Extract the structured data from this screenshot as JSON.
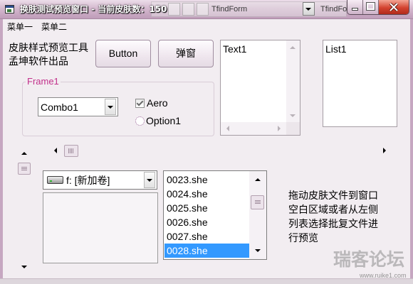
{
  "window": {
    "title": "换肤测试预览窗口 - 当前皮肤数：150",
    "background_windows": [
      "TfindForm",
      "TfindFo"
    ]
  },
  "menu": [
    "菜单一",
    "菜单二"
  ],
  "intro": [
    "皮肤样式预览工具",
    "孟坤软件出品"
  ],
  "buttons": {
    "button": "Button",
    "popup": "弹窗"
  },
  "text1": {
    "value": "Text1"
  },
  "list1": {
    "items": [
      "List1"
    ]
  },
  "frame": {
    "label": "Frame1",
    "combo": {
      "value": "Combo1"
    },
    "checkbox": {
      "label": "Aero",
      "checked": true
    },
    "radio": {
      "label": "Option1",
      "selected": false
    }
  },
  "drive": {
    "value": "f: [新加卷]",
    "icon": "hard-drive-icon"
  },
  "file_list": {
    "items": [
      "0023.she",
      "0024.she",
      "0025.she",
      "0026.she",
      "0027.she",
      "0028.she"
    ],
    "selected_index": 5
  },
  "instructions": [
    "拖动皮肤文件到窗口",
    "空白区域或者从左侧",
    "列表选择批复文件进",
    "行预览"
  ],
  "scroll": {
    "main_horizontal": 0,
    "main_vertical": 0,
    "file_list": 0.2
  },
  "watermark": {
    "name": "瑞客论坛",
    "url": "www.ruike1.com"
  },
  "colors": {
    "title_bar": "#c9a9c3",
    "client_background": "#f2edf1",
    "frame_label": "#c2308b",
    "selection": "#3399ff",
    "close_button": "#d3432f"
  },
  "icons": {
    "app": "app-icon",
    "minimize": "minimize-icon",
    "maximize": "maximize-icon",
    "close": "close-icon",
    "drive": "hard-drive-icon"
  }
}
